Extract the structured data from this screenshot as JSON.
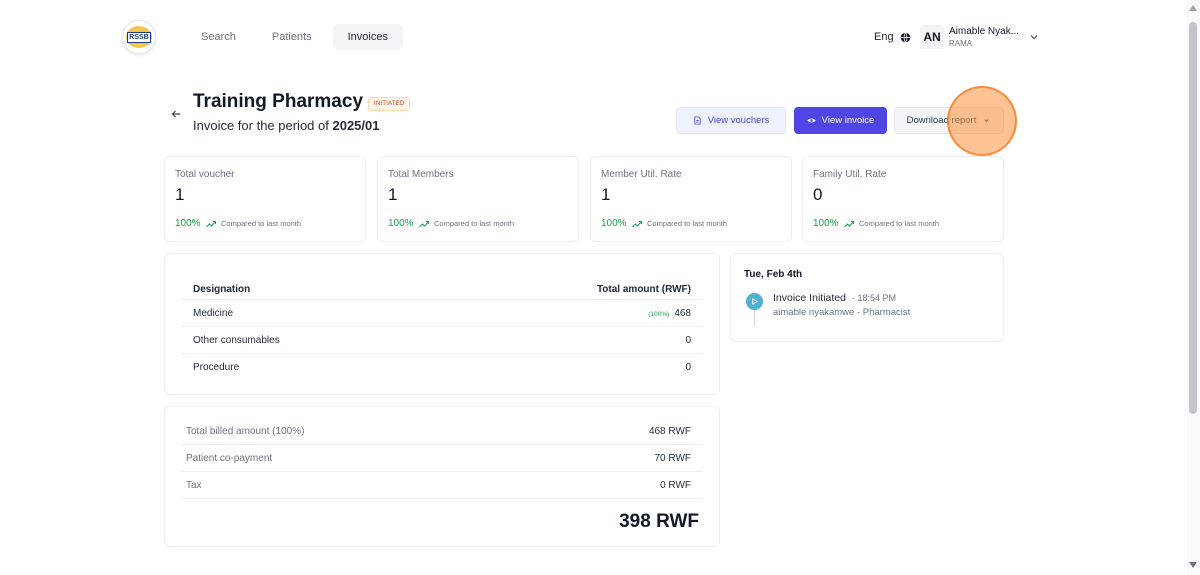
{
  "brand": {
    "logo_text": "RSSB"
  },
  "nav": {
    "items": [
      {
        "label": "Search"
      },
      {
        "label": "Patients"
      },
      {
        "label": "Invoices"
      }
    ]
  },
  "user": {
    "language": "Eng",
    "initials": "AN",
    "name": "Aimable Nyak...",
    "organization": "RAMA"
  },
  "header": {
    "title": "Training Pharmacy",
    "status": "INITIATED",
    "subtitle_prefix": "Invoice for the period of",
    "period": "2025/01"
  },
  "actions": {
    "view_vouchers": "View vouchers",
    "view_invoice": "View invoice",
    "download_report": "Download report"
  },
  "stats": [
    {
      "label": "Total voucher",
      "value": "1",
      "change": "100%",
      "compare": "Compared to last month"
    },
    {
      "label": "Total Members",
      "value": "1",
      "change": "100%",
      "compare": "Compared to last month"
    },
    {
      "label": "Member Util. Rate",
      "value": "1",
      "change": "100%",
      "compare": "Compared to last month"
    },
    {
      "label": "Family Util. Rate",
      "value": "0",
      "change": "100%",
      "compare": "Compared to last month"
    }
  ],
  "breakdown": {
    "columns": [
      "Designation",
      "Total amount (RWF)"
    ],
    "rows": [
      {
        "designation": "Medicine",
        "share": "(100%)",
        "amount": "468"
      },
      {
        "designation": "Other consumables",
        "amount": "0"
      },
      {
        "designation": "Procedure",
        "amount": "0"
      }
    ]
  },
  "totals": {
    "rows": [
      {
        "label": "Total billed amount (100%)",
        "value": "468 RWF"
      },
      {
        "label": "Patient co-payment",
        "value": "70 RWF"
      },
      {
        "label": "Tax",
        "value": "0 RWF"
      }
    ],
    "grand_total": "398 RWF"
  },
  "timeline": {
    "date": "Tue, Feb 4th",
    "event": "Invoice Initiated",
    "time": "- 18:54 PM",
    "actor": "aimable nyakamwe - Pharmacist"
  },
  "colors": {
    "primary": "#4f46e5",
    "positive": "#16a34a",
    "status_badge": "#c2410c",
    "timeline_dot": "#4fb3cf"
  }
}
